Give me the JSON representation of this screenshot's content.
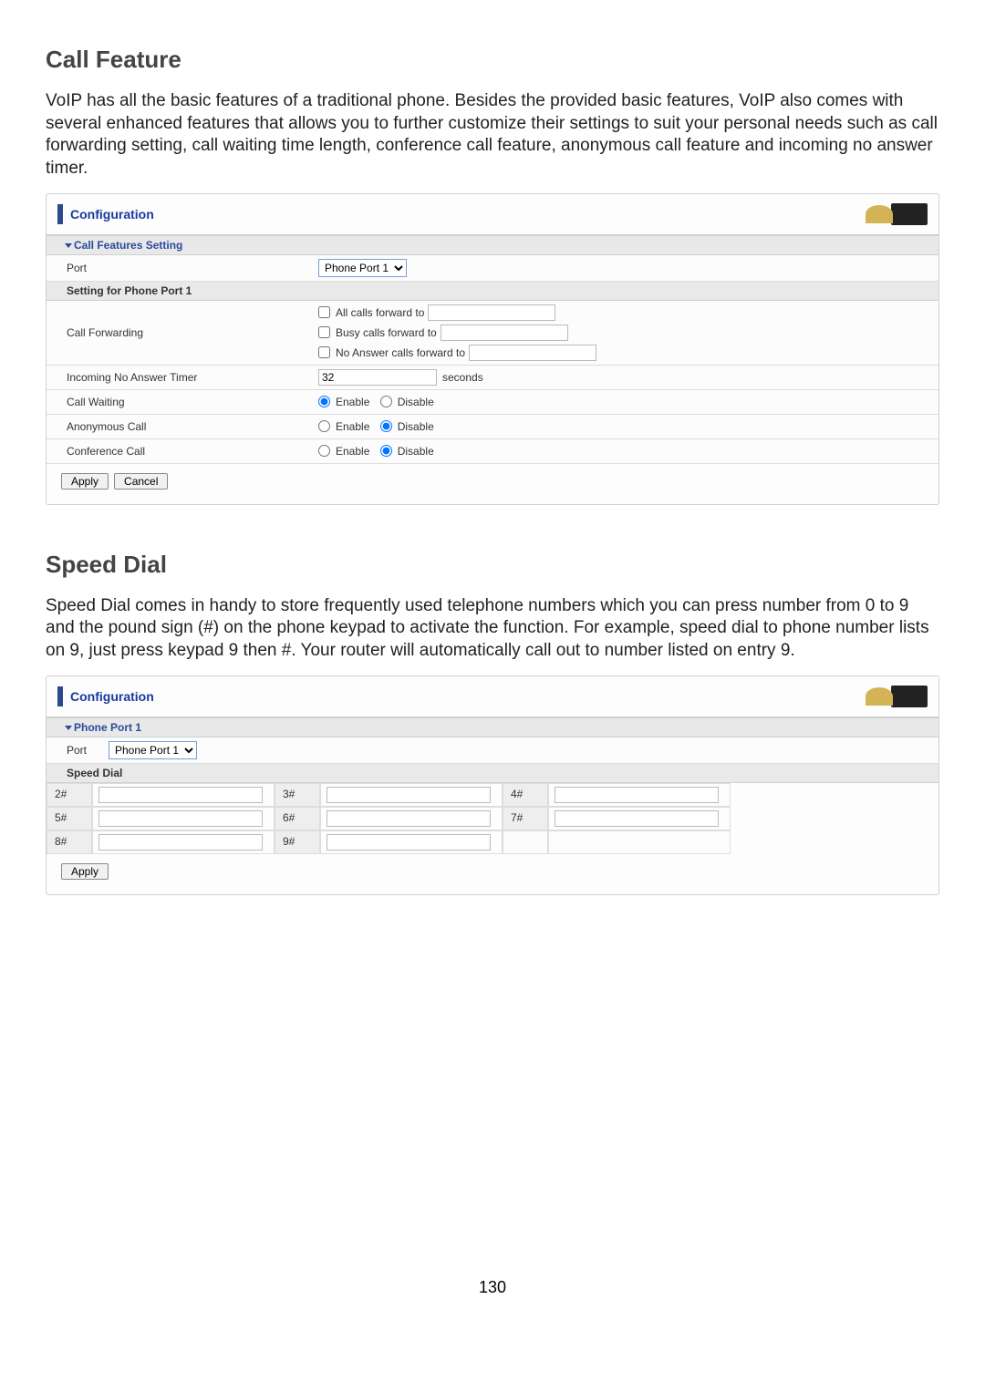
{
  "page_number": "130",
  "call_feature": {
    "heading": "Call Feature",
    "description": "VoIP has all the basic features of a traditional phone. Besides the provided basic features, VoIP also comes with several enhanced features that allows you to further customize their settings to suit your personal needs such as call forwarding setting, call waiting time length, conference call feature, anonymous call feature and incoming no answer timer.",
    "panel_title": "Configuration",
    "section_title": "Call Features Setting",
    "port_label": "Port",
    "port_value": "Phone Port 1",
    "sub_header": "Setting for Phone Port 1",
    "rows": {
      "call_forwarding": {
        "label": "Call Forwarding",
        "opt_all": "All calls forward to",
        "opt_busy": "Busy calls forward to",
        "opt_noans": "No Answer calls forward to"
      },
      "no_answer_timer": {
        "label": "Incoming No Answer Timer",
        "value": "32",
        "unit": "seconds"
      },
      "call_waiting": {
        "label": "Call Waiting",
        "enable": "Enable",
        "disable": "Disable",
        "selected": "enable"
      },
      "anon_call": {
        "label": "Anonymous Call",
        "enable": "Enable",
        "disable": "Disable",
        "selected": "disable"
      },
      "conf_call": {
        "label": "Conference Call",
        "enable": "Enable",
        "disable": "Disable",
        "selected": "disable"
      }
    },
    "apply": "Apply",
    "cancel": "Cancel"
  },
  "speed_dial": {
    "heading": "Speed Dial",
    "description": "Speed Dial comes in handy to store frequently used telephone numbers which you can press number from 0 to 9 and the pound sign (#) on the phone keypad to activate the function. For example, speed dial to phone number lists on 9, just press keypad 9 then #. Your router will automatically call out to number listed on entry 9.",
    "panel_title": "Configuration",
    "section_title": "Phone Port 1",
    "port_label": "Port",
    "port_value": "Phone Port 1",
    "sub_header": "Speed Dial",
    "entries": {
      "e2": "2#",
      "e3": "3#",
      "e4": "4#",
      "e5": "5#",
      "e6": "6#",
      "e7": "7#",
      "e8": "8#",
      "e9": "9#"
    },
    "apply": "Apply"
  }
}
